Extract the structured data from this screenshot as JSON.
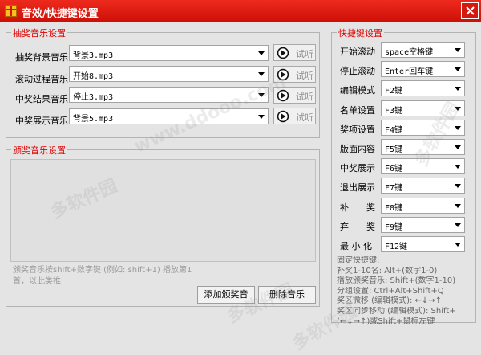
{
  "window": {
    "title": "音效/快捷键设置",
    "close_icon": "close-icon"
  },
  "lottery_music": {
    "legend": "抽奖音乐设置",
    "rows": [
      {
        "label": "抽奖背景音乐",
        "value": "背景3.mp3",
        "play_label": "试听"
      },
      {
        "label": "滚动过程音乐",
        "value": "开始8.mp3",
        "play_label": "试听"
      },
      {
        "label": "中奖结果音乐",
        "value": "停止3.mp3",
        "play_label": "试听"
      },
      {
        "label": "中奖展示音乐",
        "value": "背景5.mp3",
        "play_label": "试听"
      }
    ]
  },
  "award_music": {
    "legend": "颁奖音乐设置",
    "hint": "颁奖音乐按shift+数字键 (例如: shift+1) 播放第1首，以此类推",
    "add_button": "添加颁奖音",
    "delete_button": "删除音乐"
  },
  "hotkeys": {
    "legend": "快捷键设置",
    "rows": [
      {
        "label": "开始滚动",
        "value": "space空格键"
      },
      {
        "label": "停止滚动",
        "value": "Enter回车键"
      },
      {
        "label": "编辑模式",
        "value": "F2键"
      },
      {
        "label": "名单设置",
        "value": "F3键"
      },
      {
        "label": "奖项设置",
        "value": "F4键"
      },
      {
        "label": "版面内容",
        "value": "F5键"
      },
      {
        "label": "中奖展示",
        "value": "F6键"
      },
      {
        "label": "退出展示",
        "value": "F7键"
      },
      {
        "label": "补　　奖",
        "value": "F8键"
      },
      {
        "label": "弃　　奖",
        "value": "F9键"
      },
      {
        "label": "最 小 化",
        "value": "F12键"
      }
    ],
    "fixed_hints": [
      "固定快捷键:",
      "补奖1-10名: Alt+(数字1-0)",
      "播放颁奖音乐: Shift+(数字1-10)",
      "分组设置: Ctrl+Alt+Shift+Q",
      "奖区微移 (编辑模式): ←↓→↑",
      "奖区同步移动 (编辑模式): Shift+",
      "(←↓→↑)或Shift+鼠标左键"
    ]
  },
  "watermarks": [
    "www.ddooo.com",
    "多软件园",
    "多软件园",
    "多软件园",
    "多软件园"
  ]
}
